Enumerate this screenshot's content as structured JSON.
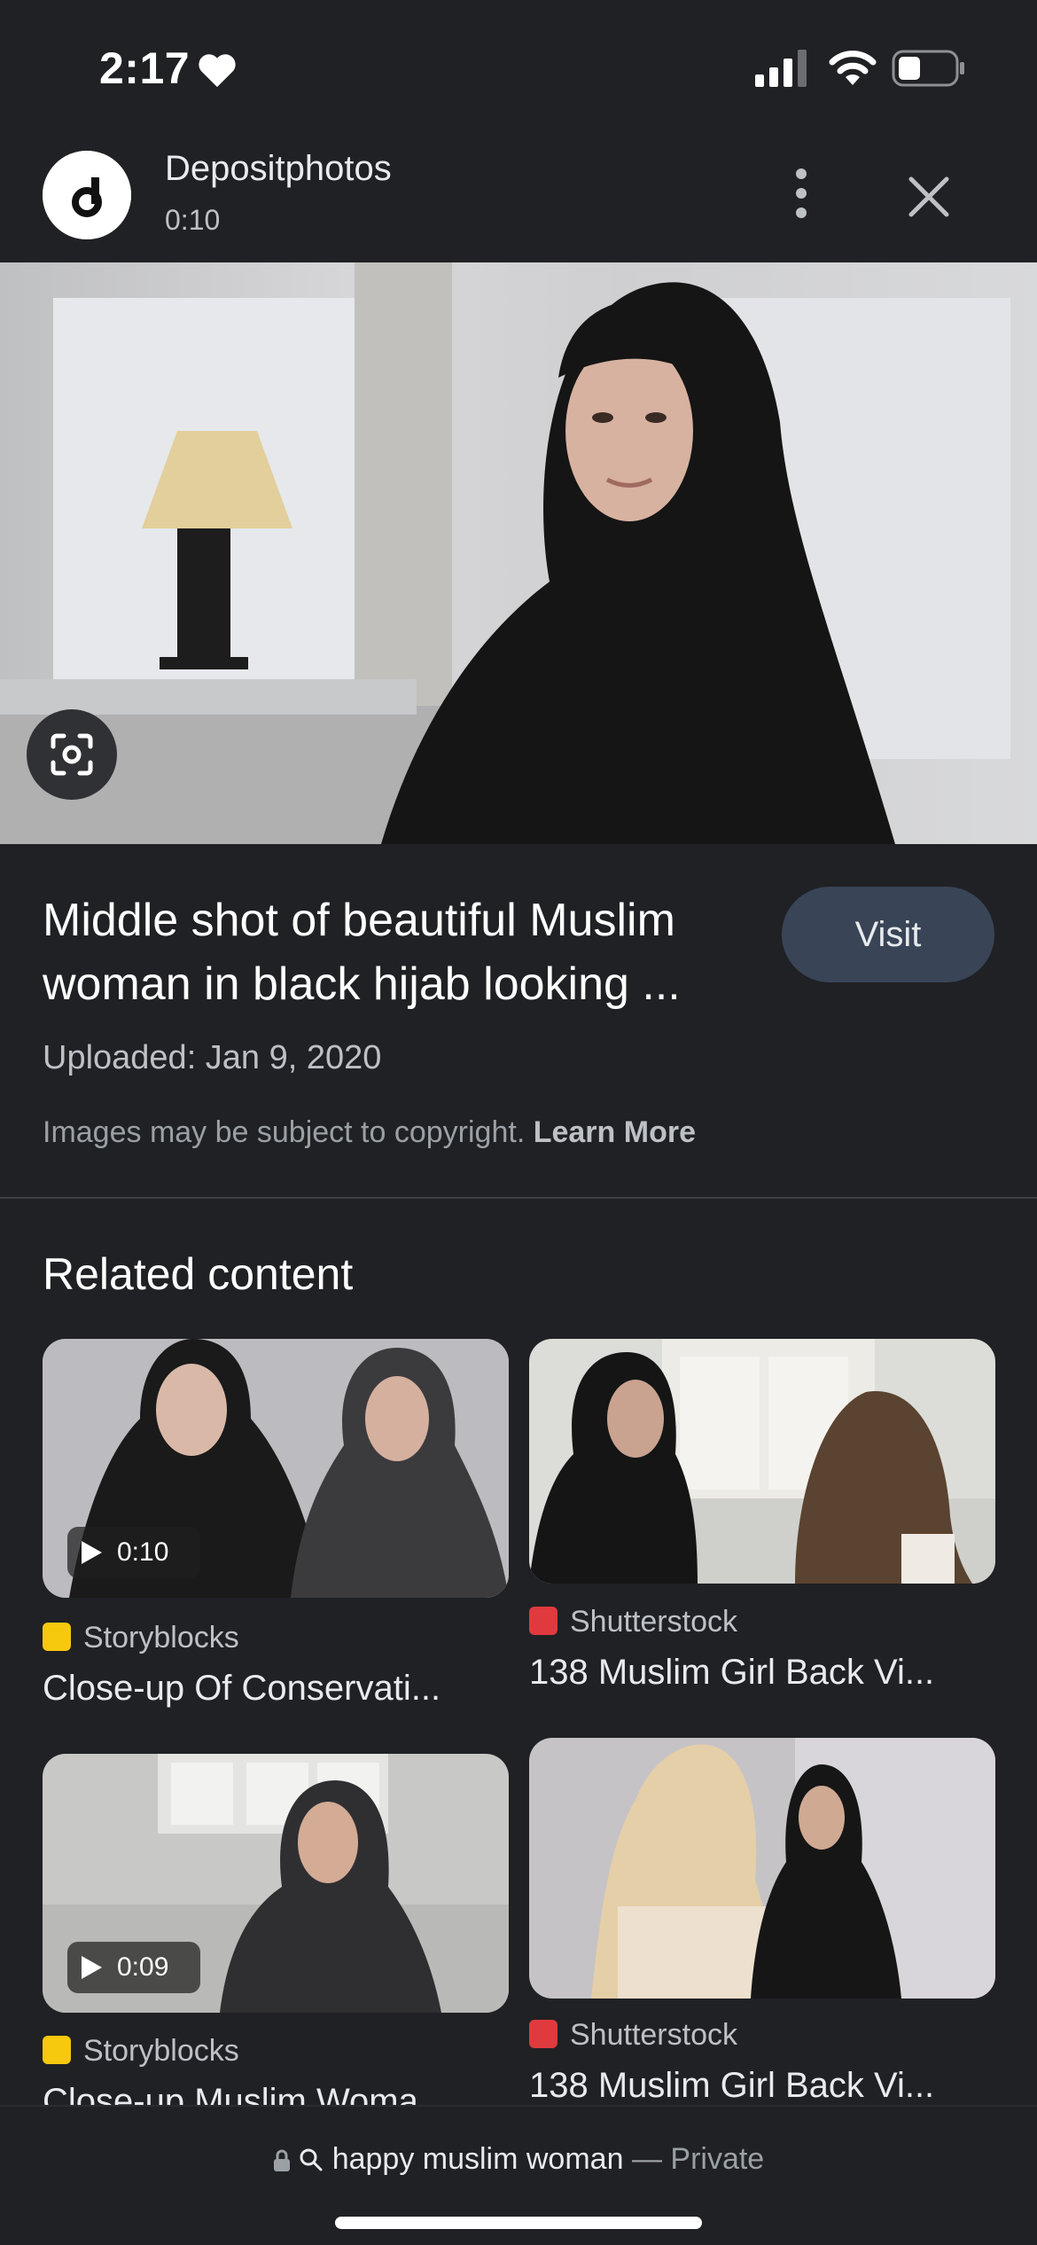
{
  "status_bar": {
    "time": "2:17"
  },
  "header": {
    "source_name": "Depositphotos",
    "duration": "0:10"
  },
  "result": {
    "title": "Middle shot of beautiful Muslim woman in black hijab looking ...",
    "visit_label": "Visit",
    "uploaded": "Uploaded: Jan 9, 2020",
    "copyright_text": "Images may be subject to copyright.",
    "learn_more": "Learn More"
  },
  "related": {
    "heading": "Related content",
    "items": [
      {
        "source": "Storyblocks",
        "title": "Close-up Of Conservati...",
        "duration": "0:10",
        "source_color": "#f6c90e"
      },
      {
        "source": "Shutterstock",
        "title": "138 Muslim Girl Back Vi...",
        "source_color": "#e03a3e"
      },
      {
        "source": "Storyblocks",
        "title": "Close-up Muslim Woma...",
        "duration": "0:09",
        "source_color": "#f6c90e"
      },
      {
        "source": "Shutterstock",
        "title": "138 Muslim Girl Back Vi...",
        "source_color": "#e03a3e"
      }
    ]
  },
  "address_bar": {
    "query": "happy muslim woman",
    "separator": "—",
    "mode": "Private"
  }
}
